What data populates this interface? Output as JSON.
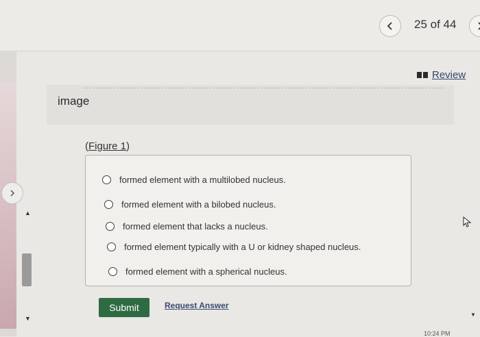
{
  "nav": {
    "position": "25 of 44",
    "prev_icon": "chevron-left-icon",
    "next_icon": "chevron-right-icon"
  },
  "review": {
    "label": "Review",
    "icon": "review-icon"
  },
  "image_placeholder": "image",
  "figure": {
    "open": "(",
    "link": "Figure 1",
    "close": ")"
  },
  "options": [
    "formed element with a multilobed nucleus.",
    "formed element with a bilobed nucleus.",
    "formed element that lacks a nucleus.",
    "formed element typically with a U or kidney shaped nucleus.",
    "formed element with a spherical nucleus."
  ],
  "buttons": {
    "submit": "Submit",
    "request_answer": "Request Answer"
  },
  "taskbar_time": "10:24 PM",
  "colors": {
    "submit_bg": "#2e6b43",
    "link": "#34466e"
  }
}
